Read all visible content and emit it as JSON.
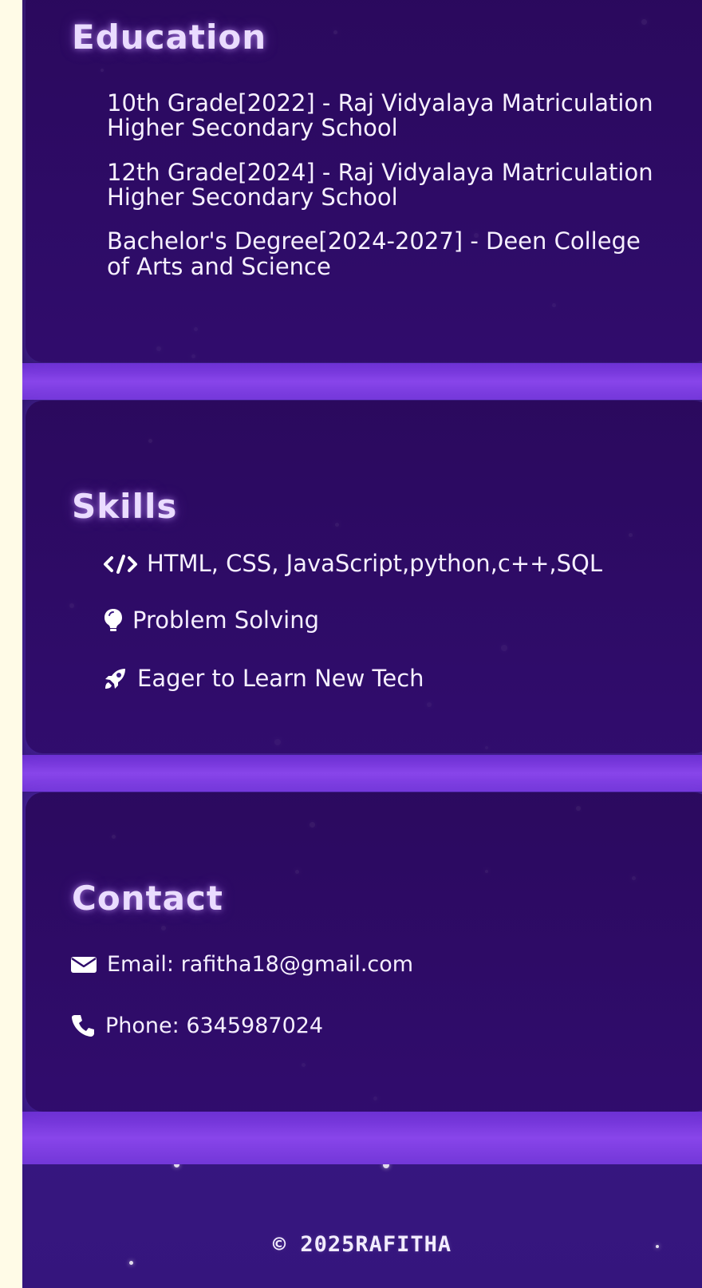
{
  "colors": {
    "page_bg": "#fffbe7",
    "viewport_bg": "#341878",
    "card_bg": "#2f0c6b",
    "band_bg": "#8845ea",
    "title": "#eadcff",
    "text": "#f5efff"
  },
  "education": {
    "title": "Education",
    "items": [
      "10th Grade[2022] - Raj Vidyalaya Matriculation Higher Secondary School",
      "12th Grade[2024] - Raj Vidyalaya Matriculation Higher Secondary School",
      "Bachelor's Degree[2024-2027] - Deen College of Arts and Science"
    ]
  },
  "skills": {
    "title": "Skills",
    "items": [
      {
        "icon": "code-icon",
        "label": "HTML, CSS, JavaScript,python,c++,SQL"
      },
      {
        "icon": "lightbulb-icon",
        "label": "Problem Solving"
      },
      {
        "icon": "rocket-icon",
        "label": "Eager to Learn New Tech"
      }
    ]
  },
  "contact": {
    "title": "Contact",
    "items": [
      {
        "icon": "email-icon",
        "label": "Email: rafitha18@gmail.com"
      },
      {
        "icon": "phone-icon",
        "label": "Phone: 6345987024"
      }
    ]
  },
  "footer": {
    "text": "© 2025RAFITHA"
  }
}
